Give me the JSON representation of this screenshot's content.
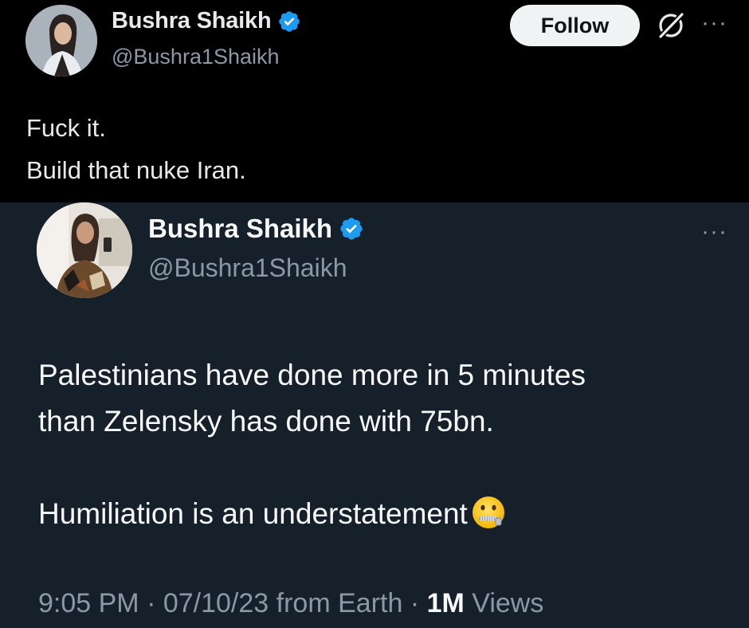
{
  "quote_tweet": {
    "author": {
      "display_name": "Bushra Shaikh",
      "handle": "@Bushra1Shaikh",
      "verified": true
    },
    "follow_label": "Follow",
    "grok_icon": "grok-slash-icon",
    "more_icon": "ellipsis-icon",
    "body_lines": [
      "Fuck it.",
      "Build that nuke Iran."
    ]
  },
  "original_tweet": {
    "author": {
      "display_name": "Bushra Shaikh",
      "handle": "@Bushra1Shaikh",
      "verified": true
    },
    "more_icon": "ellipsis-icon",
    "paragraph_1_line_1": "Palestinians have done more in 5 minutes",
    "paragraph_1_line_2": "than Zelensky has done with 75bn.",
    "paragraph_2": "Humiliation is an understatement",
    "emoji": "zipper-mouth-face",
    "meta": {
      "time": "9:05 PM",
      "separator": " · ",
      "date": "07/10/23",
      "source": " from Earth",
      "views_count": "1M",
      "views_label": " Views"
    }
  },
  "colors": {
    "top_background": "#000000",
    "bottom_background": "#15202b",
    "verified_blue": "#1d9bf0",
    "secondary_text": "#8b98a5",
    "primary_text": "#e7e9ea"
  }
}
